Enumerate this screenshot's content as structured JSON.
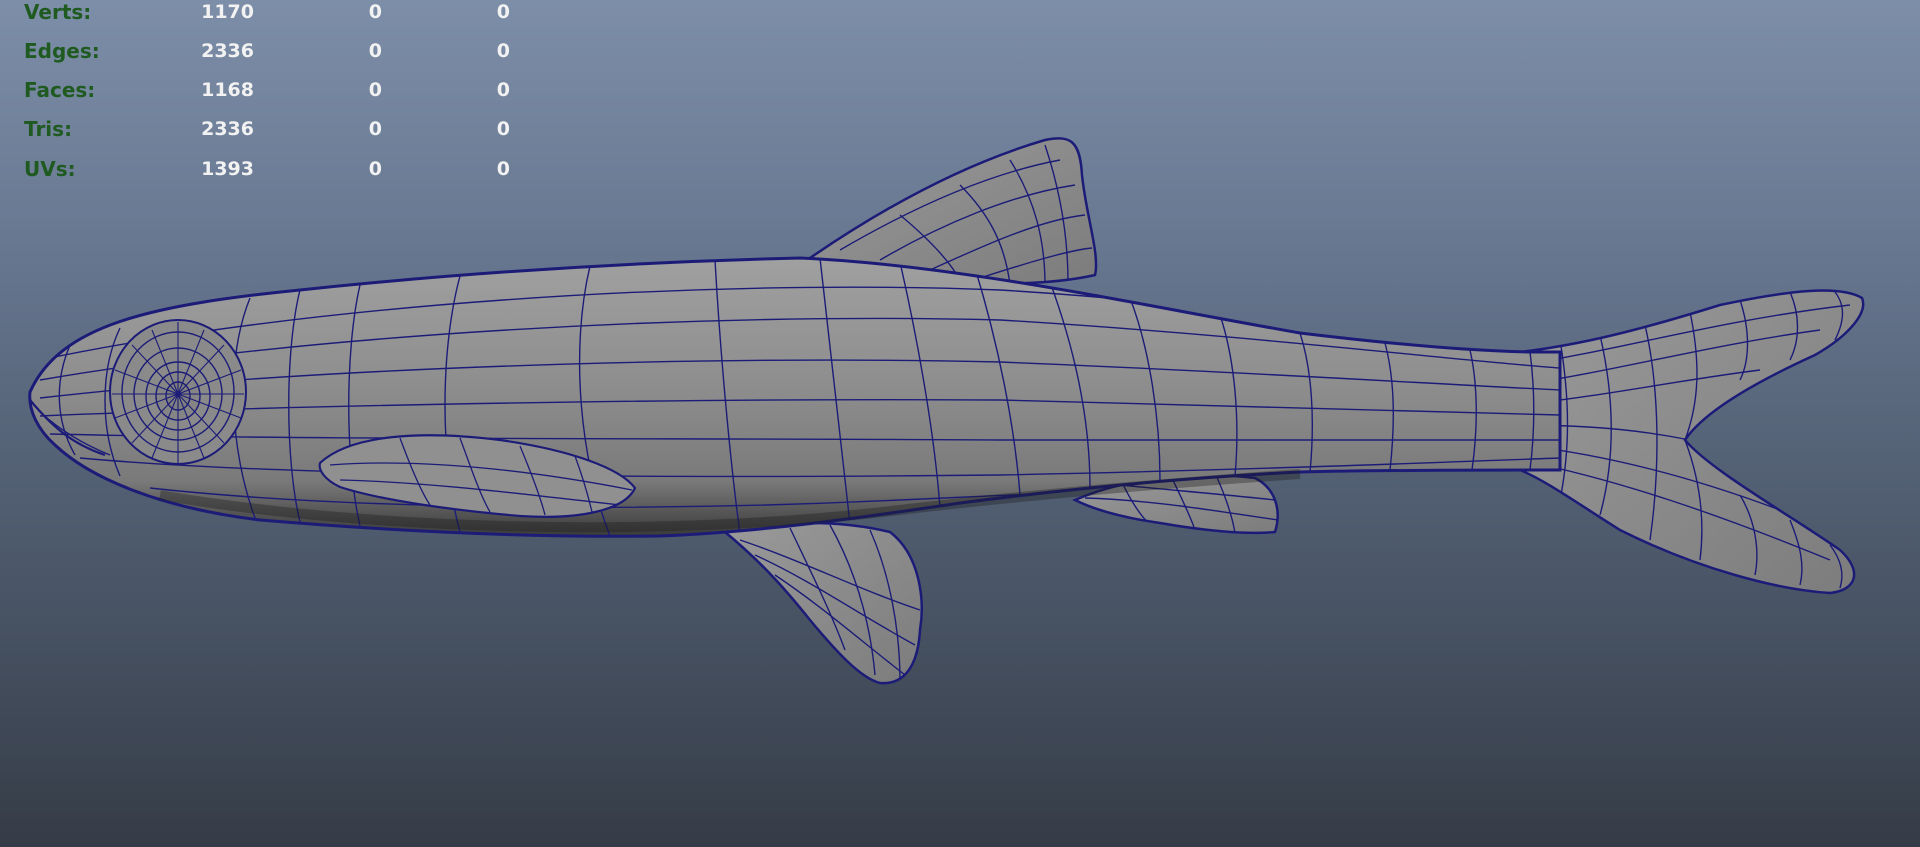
{
  "hud": {
    "rows": [
      {
        "label": "Verts:",
        "values": [
          "1170",
          "0",
          "0"
        ]
      },
      {
        "label": "Edges:",
        "values": [
          "2336",
          "0",
          "0"
        ]
      },
      {
        "label": "Faces:",
        "values": [
          "1168",
          "0",
          "0"
        ]
      },
      {
        "label": "Tris:",
        "values": [
          "2336",
          "0",
          "0"
        ]
      },
      {
        "label": "UVs:",
        "values": [
          "1393",
          "0",
          "0"
        ]
      }
    ]
  },
  "colors": {
    "hud_label": "#1f5a20",
    "hud_value": "#f2f2f2",
    "wireframe": "#1c1c78",
    "mesh_fill": "#8c8c8c",
    "background_top": "#7d8ea8",
    "background_bottom": "#353c47"
  },
  "scene": {
    "model_icon": "fish-mesh-icon"
  }
}
